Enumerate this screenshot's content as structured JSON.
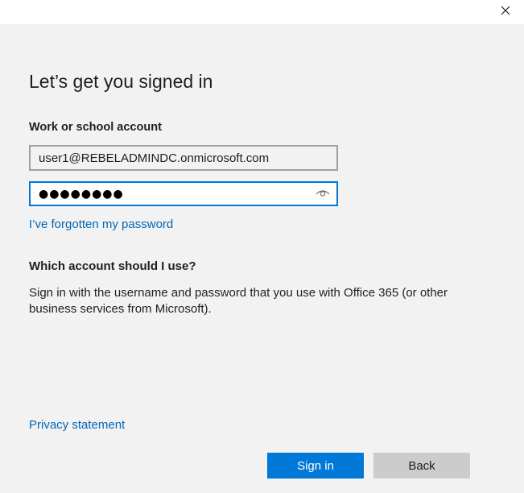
{
  "dialog": {
    "heading": "Let’s get you signed in",
    "account_label": "Work or school account",
    "username_value": "user1@REBELADMINDC.onmicrosoft.com",
    "password_value": "●●●●●●●●",
    "forgot_link": "I’ve forgotten my password",
    "which_account_heading": "Which account should I use?",
    "which_account_text": "Sign in with the username and password that you use with Office 365 (or other business services from Microsoft).",
    "privacy_link": "Privacy statement",
    "sign_in_label": "Sign in",
    "back_label": "Back"
  },
  "icons": {
    "close": "close-icon",
    "reveal_password": "eye-icon"
  },
  "colors": {
    "accent": "#0078d7",
    "link": "#0067b8",
    "background": "#f2f2f2",
    "secondary_button": "#cccccc"
  }
}
